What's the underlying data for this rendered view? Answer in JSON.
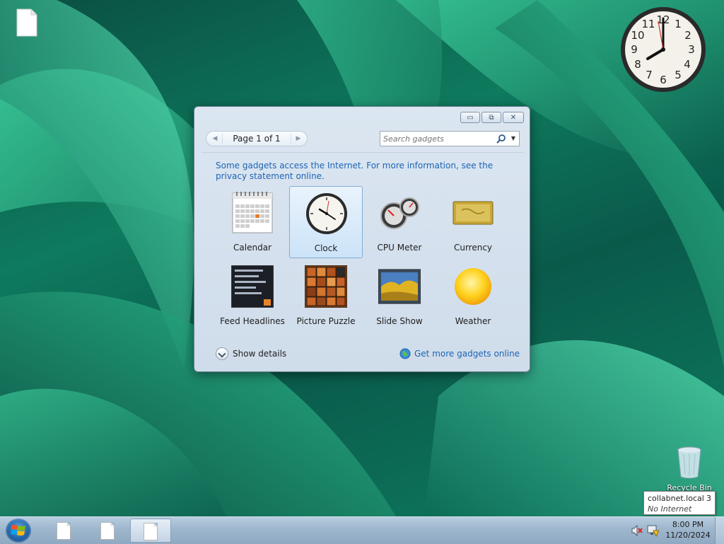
{
  "desktop": {
    "recycle_bin_label": "Recycle Bin",
    "tooltip": {
      "network": "collabnet.local",
      "count": "3",
      "status": "No Internet access"
    }
  },
  "window": {
    "controls": {
      "minimize": "▭",
      "maximize": "⧉",
      "close": "✕"
    },
    "pager": {
      "text": "Page 1 of 1",
      "prev": "◀",
      "next": "▶"
    },
    "search": {
      "placeholder": "Search gadgets",
      "dropdown": "▼"
    },
    "info": {
      "text": "Some gadgets access the Internet.  For more information, see the privacy statement online."
    },
    "gadgets": [
      {
        "name": "Calendar",
        "icon": "calendar-icon",
        "selected": false
      },
      {
        "name": "Clock",
        "icon": "clock-icon",
        "selected": true
      },
      {
        "name": "CPU Meter",
        "icon": "cpu-meter-icon",
        "selected": false
      },
      {
        "name": "Currency",
        "icon": "currency-icon",
        "selected": false
      },
      {
        "name": "Feed Headlines",
        "icon": "feed-headlines-icon",
        "selected": false
      },
      {
        "name": "Picture Puzzle",
        "icon": "picture-puzzle-icon",
        "selected": false
      },
      {
        "name": "Slide Show",
        "icon": "slide-show-icon",
        "selected": false
      },
      {
        "name": "Weather",
        "icon": "weather-icon",
        "selected": false
      }
    ],
    "show_details": "Show details",
    "get_more": "Get more gadgets online"
  },
  "taskbar": {
    "time": "8:00 PM",
    "date": "11/20/2024"
  },
  "colors": {
    "link": "#1e64b4",
    "selection_bg": "#cce3f8",
    "wallpaper": "#0e7a5e"
  }
}
